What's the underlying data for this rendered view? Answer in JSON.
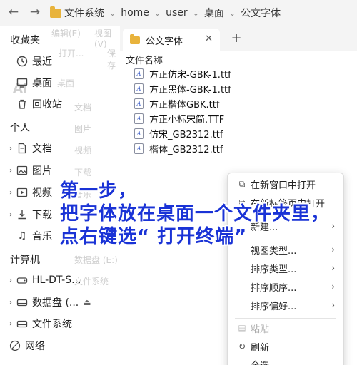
{
  "nav": {
    "back_icon": "←",
    "forward_icon": "→"
  },
  "breadcrumb": [
    "文件系统",
    "home",
    "user",
    "桌面",
    "公文字体"
  ],
  "ghost": {
    "menu_edit": "编辑(E)",
    "menu_view": "视图(V)",
    "open": "打开...",
    "save": "保存",
    "ai": "AI",
    "desktop": "桌面",
    "docs": "文档",
    "pictures": "图片",
    "videos": "视频",
    "downloads": "下载",
    "music": "音乐",
    "datadisk": "数据盘 (E:)",
    "filesystem": "文件系统"
  },
  "sidebar": {
    "favorites_heading": "收藏夹",
    "favorites": [
      {
        "label": "最近",
        "icon": "clock-icon"
      },
      {
        "label": "桌面",
        "icon": "desktop-icon"
      },
      {
        "label": "回收站",
        "icon": "trash-icon"
      }
    ],
    "personal_heading": "个人",
    "personal": [
      {
        "label": "文档",
        "icon": "document-icon"
      },
      {
        "label": "图片",
        "icon": "picture-icon"
      },
      {
        "label": "视频",
        "icon": "video-icon"
      },
      {
        "label": "下载",
        "icon": "download-icon"
      },
      {
        "label": "音乐",
        "icon": "music-icon"
      }
    ],
    "computer_heading": "计算机",
    "computer": [
      {
        "label": "HL-DT-S...",
        "icon": "optical-drive-icon"
      },
      {
        "label": "数据盘 (...",
        "icon": "drive-icon",
        "eject": "⏏"
      },
      {
        "label": "文件系统",
        "icon": "drive-icon"
      }
    ],
    "network_label": "网络"
  },
  "tabs": [
    {
      "label": "公文字体"
    }
  ],
  "tab_add_label": "+",
  "main": {
    "column_header": "文件名称",
    "files": [
      "方正仿宋-GBK-1.ttf",
      "方正黑体-GBK-1.ttf",
      "方正楷体GBK.ttf",
      "方正小标宋简.TTF",
      "仿宋_GB2312.ttf",
      "楷体_GB2312.ttf"
    ]
  },
  "context_menu": {
    "items": [
      {
        "label": "在新窗口中打开",
        "icon": "new-window-icon"
      },
      {
        "label": "在新标签页中打开",
        "icon": "new-tab-icon"
      },
      {
        "label": "新建...",
        "submenu": "›"
      },
      {
        "label": "视图类型...",
        "submenu": "›"
      },
      {
        "label": "排序类型...",
        "submenu": "›"
      },
      {
        "label": "排序顺序...",
        "submenu": "›"
      },
      {
        "label": "排序偏好...",
        "submenu": "›"
      },
      {
        "label": "粘贴",
        "icon": "paste-icon",
        "disabled": true
      },
      {
        "label": "刷新",
        "icon": "refresh-icon"
      },
      {
        "label": "全选"
      }
    ]
  },
  "annotation": {
    "line1": "第一步，",
    "line2": "把字体放在桌面一个文件夹里，",
    "line3": "点右键选“ 打开终端”"
  },
  "colors": {
    "annotation": "#1a33d6",
    "folder": "#e8b33c"
  }
}
